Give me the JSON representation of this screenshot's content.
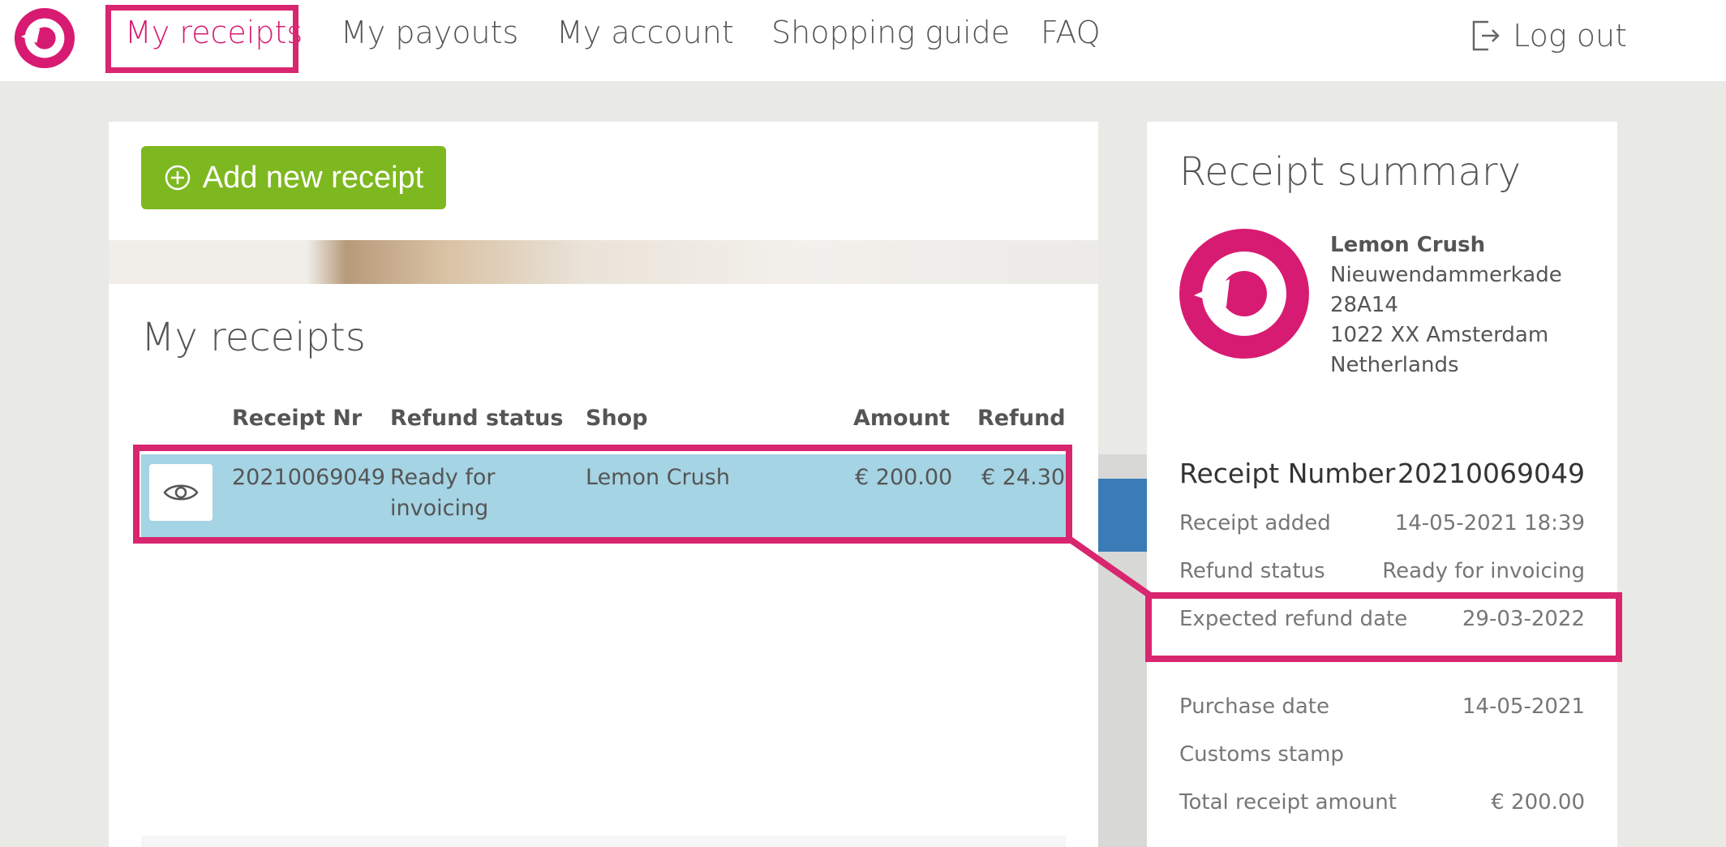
{
  "nav": {
    "items": [
      {
        "label": "My receipts",
        "active": true
      },
      {
        "label": "My payouts"
      },
      {
        "label": "My account"
      },
      {
        "label": "Shopping guide"
      },
      {
        "label": "FAQ"
      }
    ],
    "logout_label": "Log out"
  },
  "actions": {
    "add_receipt_label": "Add new receipt"
  },
  "receipts": {
    "title": "My receipts",
    "columns": [
      "Receipt Nr",
      "Refund status",
      "Shop",
      "Amount",
      "Refund"
    ],
    "rows": [
      {
        "receipt_nr": "20210069049",
        "status_line1": "Ready for",
        "status_line2": "invoicing",
        "shop": "Lemon Crush",
        "amount": "€ 200.00",
        "refund": "€ 24.30"
      }
    ]
  },
  "summary": {
    "title": "Receipt summary",
    "shop": {
      "name": "Lemon Crush",
      "street": "Nieuwendammerkade",
      "number": "28A14",
      "city": "1022 XX Amsterdam",
      "country": "Netherlands"
    },
    "receipt_number_label": "Receipt Number",
    "receipt_number": "20210069049",
    "fields": [
      {
        "label": "Receipt added",
        "value": "14-05-2021 18:39"
      },
      {
        "label": "Refund status",
        "value": "Ready for invoicing"
      },
      {
        "label": "Expected refund date",
        "value": "29-03-2022"
      },
      {
        "label": "Purchase date",
        "value": "14-05-2021"
      },
      {
        "label": "Customs stamp",
        "value": ""
      },
      {
        "label": "Total receipt amount",
        "value": "€ 200.00"
      }
    ]
  },
  "colors": {
    "brand": "#d81b72",
    "highlight": "#d8266f",
    "add_button": "#7eb820",
    "row_selected": "#a5d4e4"
  }
}
